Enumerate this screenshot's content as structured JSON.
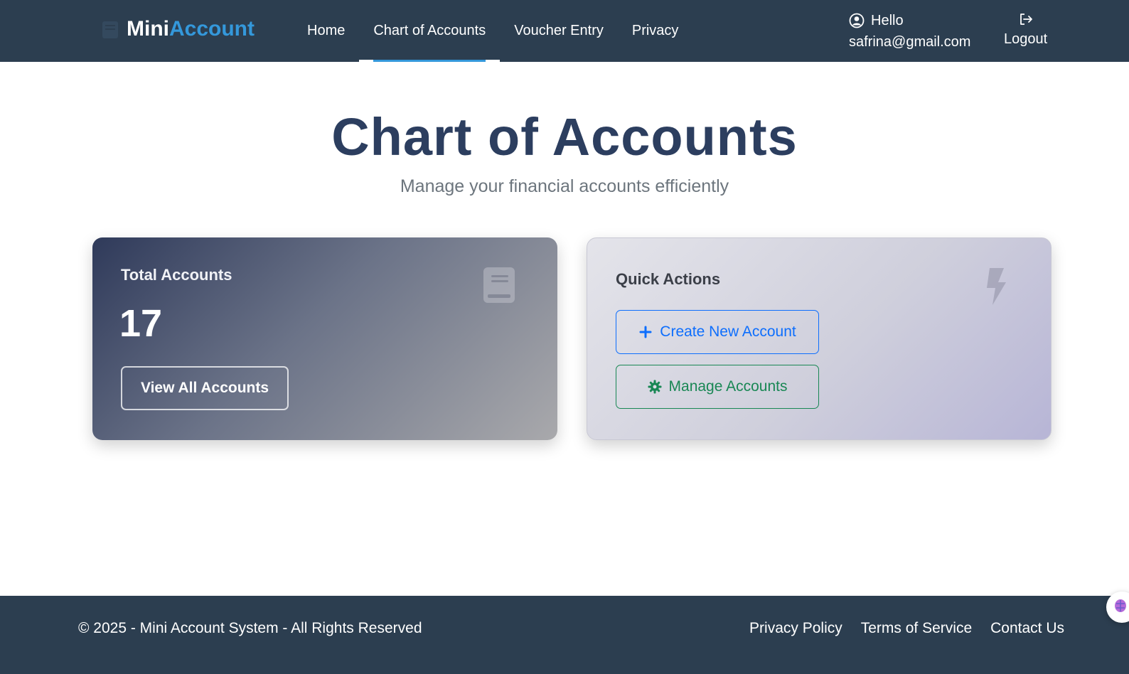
{
  "brand": {
    "part1": "Mini",
    "part2": "Account",
    "icon": "ledger-icon"
  },
  "nav": {
    "items": [
      {
        "label": "Home"
      },
      {
        "label": "Chart of Accounts",
        "active": true
      },
      {
        "label": "Voucher Entry"
      },
      {
        "label": "Privacy"
      }
    ]
  },
  "user": {
    "greeting": "Hello",
    "email": "safrina@gmail.com",
    "icon": "user-circle-icon"
  },
  "logout": {
    "label": "Logout",
    "icon": "logout-icon"
  },
  "page": {
    "title": "Chart of Accounts",
    "subtitle": "Manage your financial accounts efficiently"
  },
  "total_card": {
    "heading": "Total Accounts",
    "value": "17",
    "button_label": "View All Accounts",
    "icon": "book-icon"
  },
  "actions_card": {
    "heading": "Quick Actions",
    "icon": "bolt-icon",
    "create_label": "Create New Account",
    "create_icon": "plus-icon",
    "manage_label": "Manage Accounts",
    "manage_icon": "gear-icon"
  },
  "footer": {
    "copyright": "© 2025 - Mini Account System - All Rights Reserved",
    "links": [
      {
        "label": "Privacy Policy"
      },
      {
        "label": "Terms of Service"
      },
      {
        "label": "Contact Us"
      }
    ]
  },
  "colors": {
    "navbar": "#2c3e50",
    "accent": "#3498db",
    "primary": "#0d6efd",
    "success": "#198754"
  }
}
